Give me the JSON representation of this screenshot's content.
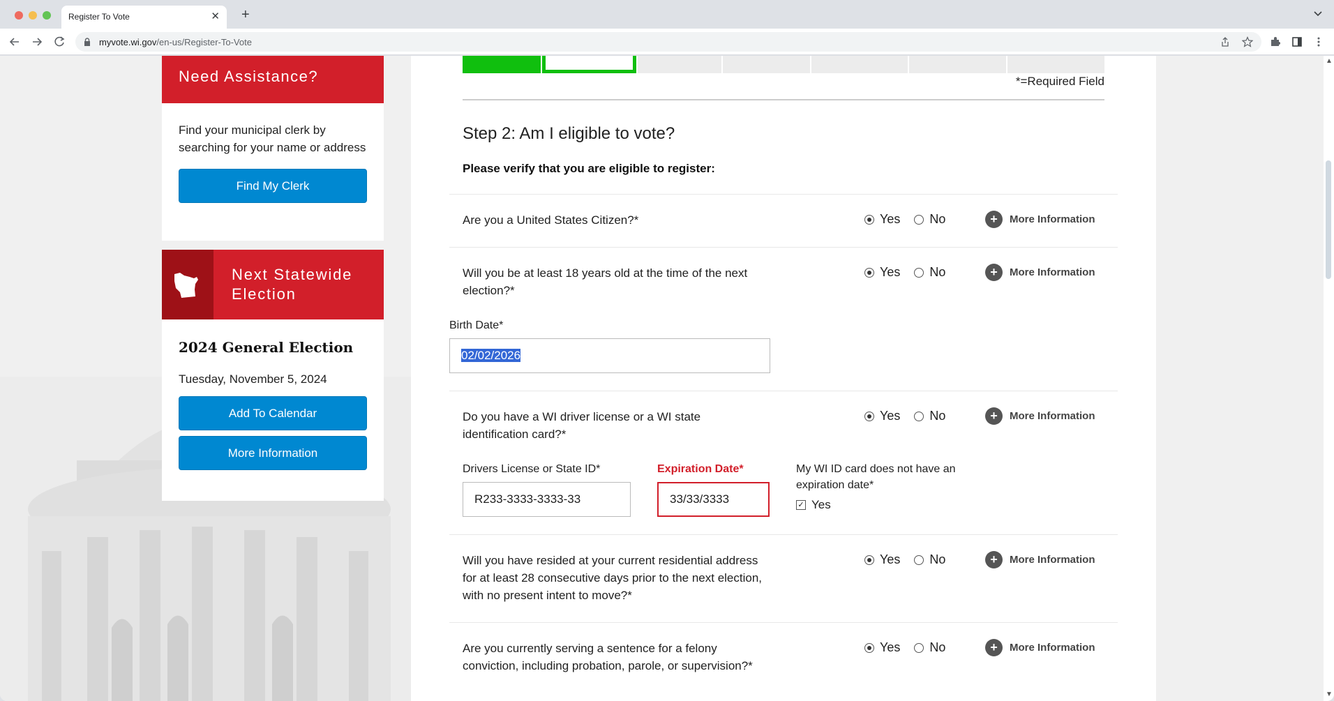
{
  "browser": {
    "tab_title": "Register To Vote",
    "url_host": "myvote.wi.gov",
    "url_path": "/en-us/Register-To-Vote"
  },
  "sidebar": {
    "assistance": {
      "title": "Need Assistance?",
      "body": "Find your municipal clerk by searching for your name or address",
      "button": "Find My Clerk"
    },
    "election": {
      "header": "Next Statewide Election",
      "name": "2024 General Election",
      "date": "Tuesday, November 5, 2024",
      "buttons": [
        "Add To Calendar",
        "More Information"
      ]
    }
  },
  "progress": {
    "total_steps": 7,
    "current_step": 2,
    "completed_steps": 1
  },
  "colors": {
    "brand_red": "#d21f2a",
    "dark_red": "#9e1117",
    "button_blue": "#0088d1",
    "progress_green": "#10bf0e"
  },
  "form": {
    "required_note": "*=Required Field",
    "step_title": "Step 2: Am I eligible to vote?",
    "subtitle": "Please verify that you are eligible to register:",
    "yes_label": "Yes",
    "no_label": "No",
    "more_info_label": "More Information",
    "questions": [
      {
        "text": "Are you a United States Citizen?*",
        "answer": "Yes"
      },
      {
        "text": "Will you be at least 18 years old at the time of the next election?*",
        "answer": "Yes"
      },
      {
        "text": "Do you have a WI driver license or a WI state identification card?*",
        "answer": "Yes"
      },
      {
        "text": "Will you have resided at your current residential address for at least 28 consecutive days prior to the next election, with no present intent to move?*",
        "answer": "Yes"
      },
      {
        "text": "Are you currently serving a sentence for a felony conviction, including probation, parole, or supervision?*",
        "answer": "Yes"
      }
    ],
    "birth_date": {
      "label": "Birth Date*",
      "value": "02/02/2026"
    },
    "license": {
      "label": "Drivers License or State ID*",
      "value": "R233-3333-3333-33"
    },
    "expiration": {
      "label": "Expiration Date*",
      "value": "33/33/3333"
    },
    "no_expiration": {
      "label": "My WI ID card does not have an expiration date*",
      "checkbox_label": "Yes",
      "checked": true
    }
  }
}
